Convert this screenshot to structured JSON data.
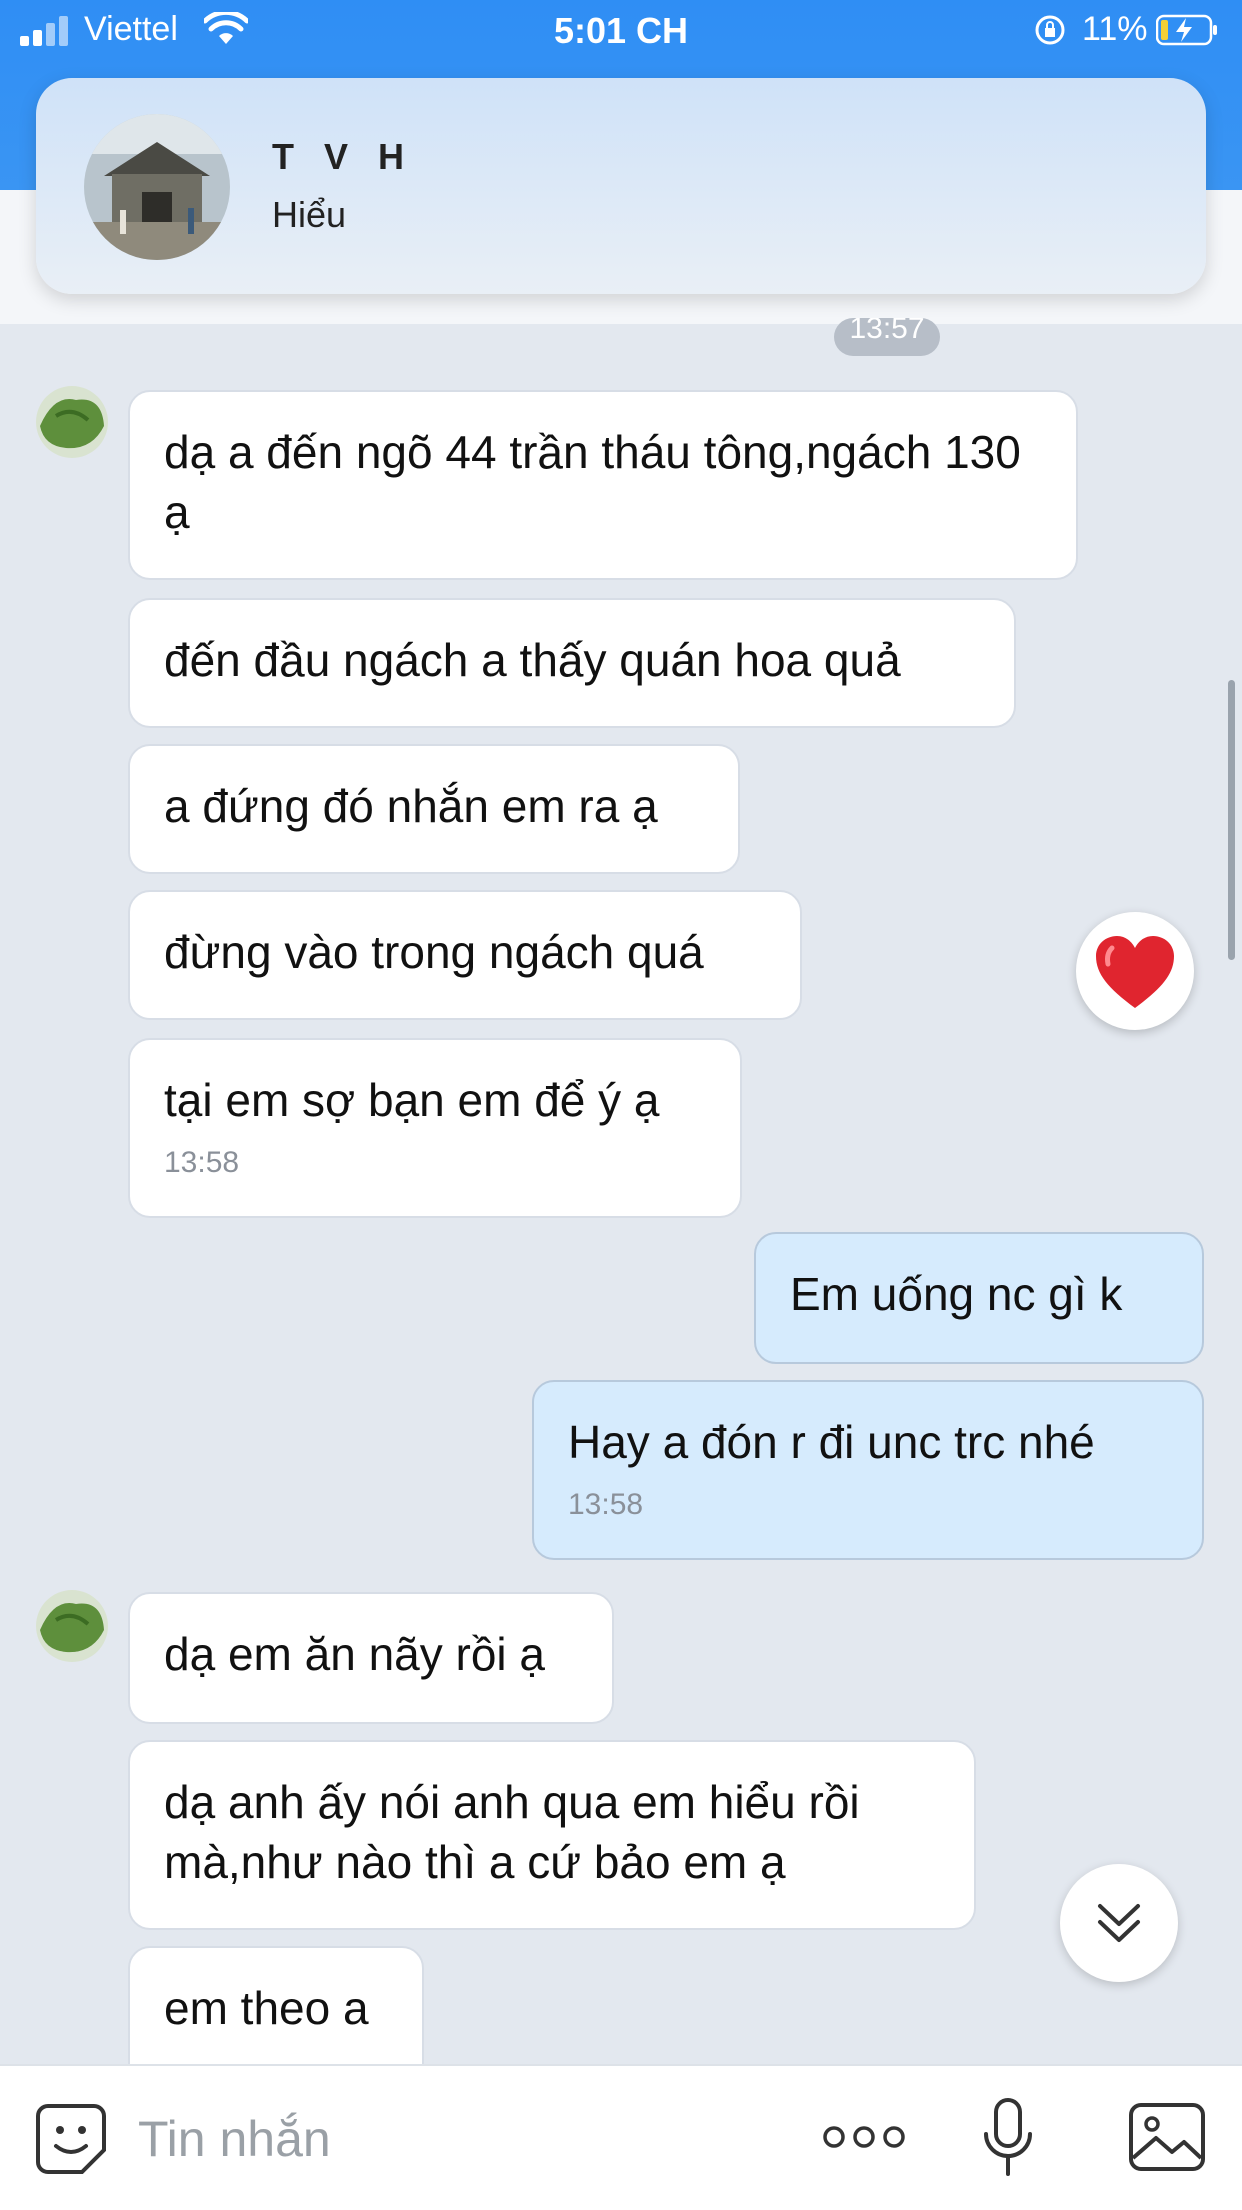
{
  "status_bar": {
    "carrier": "Viettel",
    "time": "5:01 CH",
    "battery_percent": "11%"
  },
  "notification": {
    "title": "T V H",
    "body": "Hiểu"
  },
  "chat": {
    "time_chip": "13:57",
    "groups": [
      {
        "direction": "incoming",
        "messages": [
          {
            "text": "dạ a đến ngõ 44 trần tháu tông,ngách 130 ạ"
          },
          {
            "text": "đến đầu ngách a thấy quán hoa quả"
          },
          {
            "text": "a đứng đó nhắn em ra ạ"
          },
          {
            "text": "đừng vào trong ngách quá"
          },
          {
            "text": "tại em sợ bạn em để ý ạ",
            "time": "13:58"
          }
        ]
      },
      {
        "direction": "outgoing",
        "messages": [
          {
            "text": "Em uống nc gì k"
          },
          {
            "text": "Hay a đón r đi unc trc nhé",
            "time": "13:58"
          }
        ]
      },
      {
        "direction": "incoming",
        "messages": [
          {
            "text": "dạ em ăn nãy rồi ạ"
          },
          {
            "text": "dạ anh ấy nói anh qua em hiểu rồi mà,như nào thì a cứ bảo em ạ"
          },
          {
            "text": "em theo a"
          }
        ]
      }
    ]
  },
  "input_bar": {
    "placeholder": "Tin nhắn"
  },
  "icons": {
    "reaction": "heart-icon",
    "scroll_down": "double-chevron-down-icon",
    "sticker": "sticker-icon",
    "more": "more-dots-icon",
    "mic": "microphone-icon",
    "image": "image-icon"
  },
  "colors": {
    "header_blue": "#2f8ef4",
    "chat_background": "#e3e8ef",
    "outgoing_bubble": "#d6ebfd",
    "incoming_bubble": "#ffffff",
    "heart_red": "#e0252f"
  }
}
